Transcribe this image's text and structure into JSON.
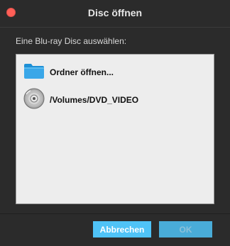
{
  "window": {
    "title": "Disc öffnen",
    "close_icon": "close-icon"
  },
  "prompt": "Eine Blu-ray Disc auswählen:",
  "list": {
    "items": [
      {
        "label": "Ordner öffnen...",
        "icon": "folder-icon"
      },
      {
        "label": "/Volumes/DVD_VIDEO",
        "icon": "disc-icon"
      }
    ]
  },
  "buttons": {
    "cancel_label": "Abbrechen",
    "ok_label": "OK"
  },
  "colors": {
    "accent": "#4fc3f7",
    "close": "#ff5f57",
    "background": "#2b2b2b",
    "list_background": "#ededed"
  }
}
